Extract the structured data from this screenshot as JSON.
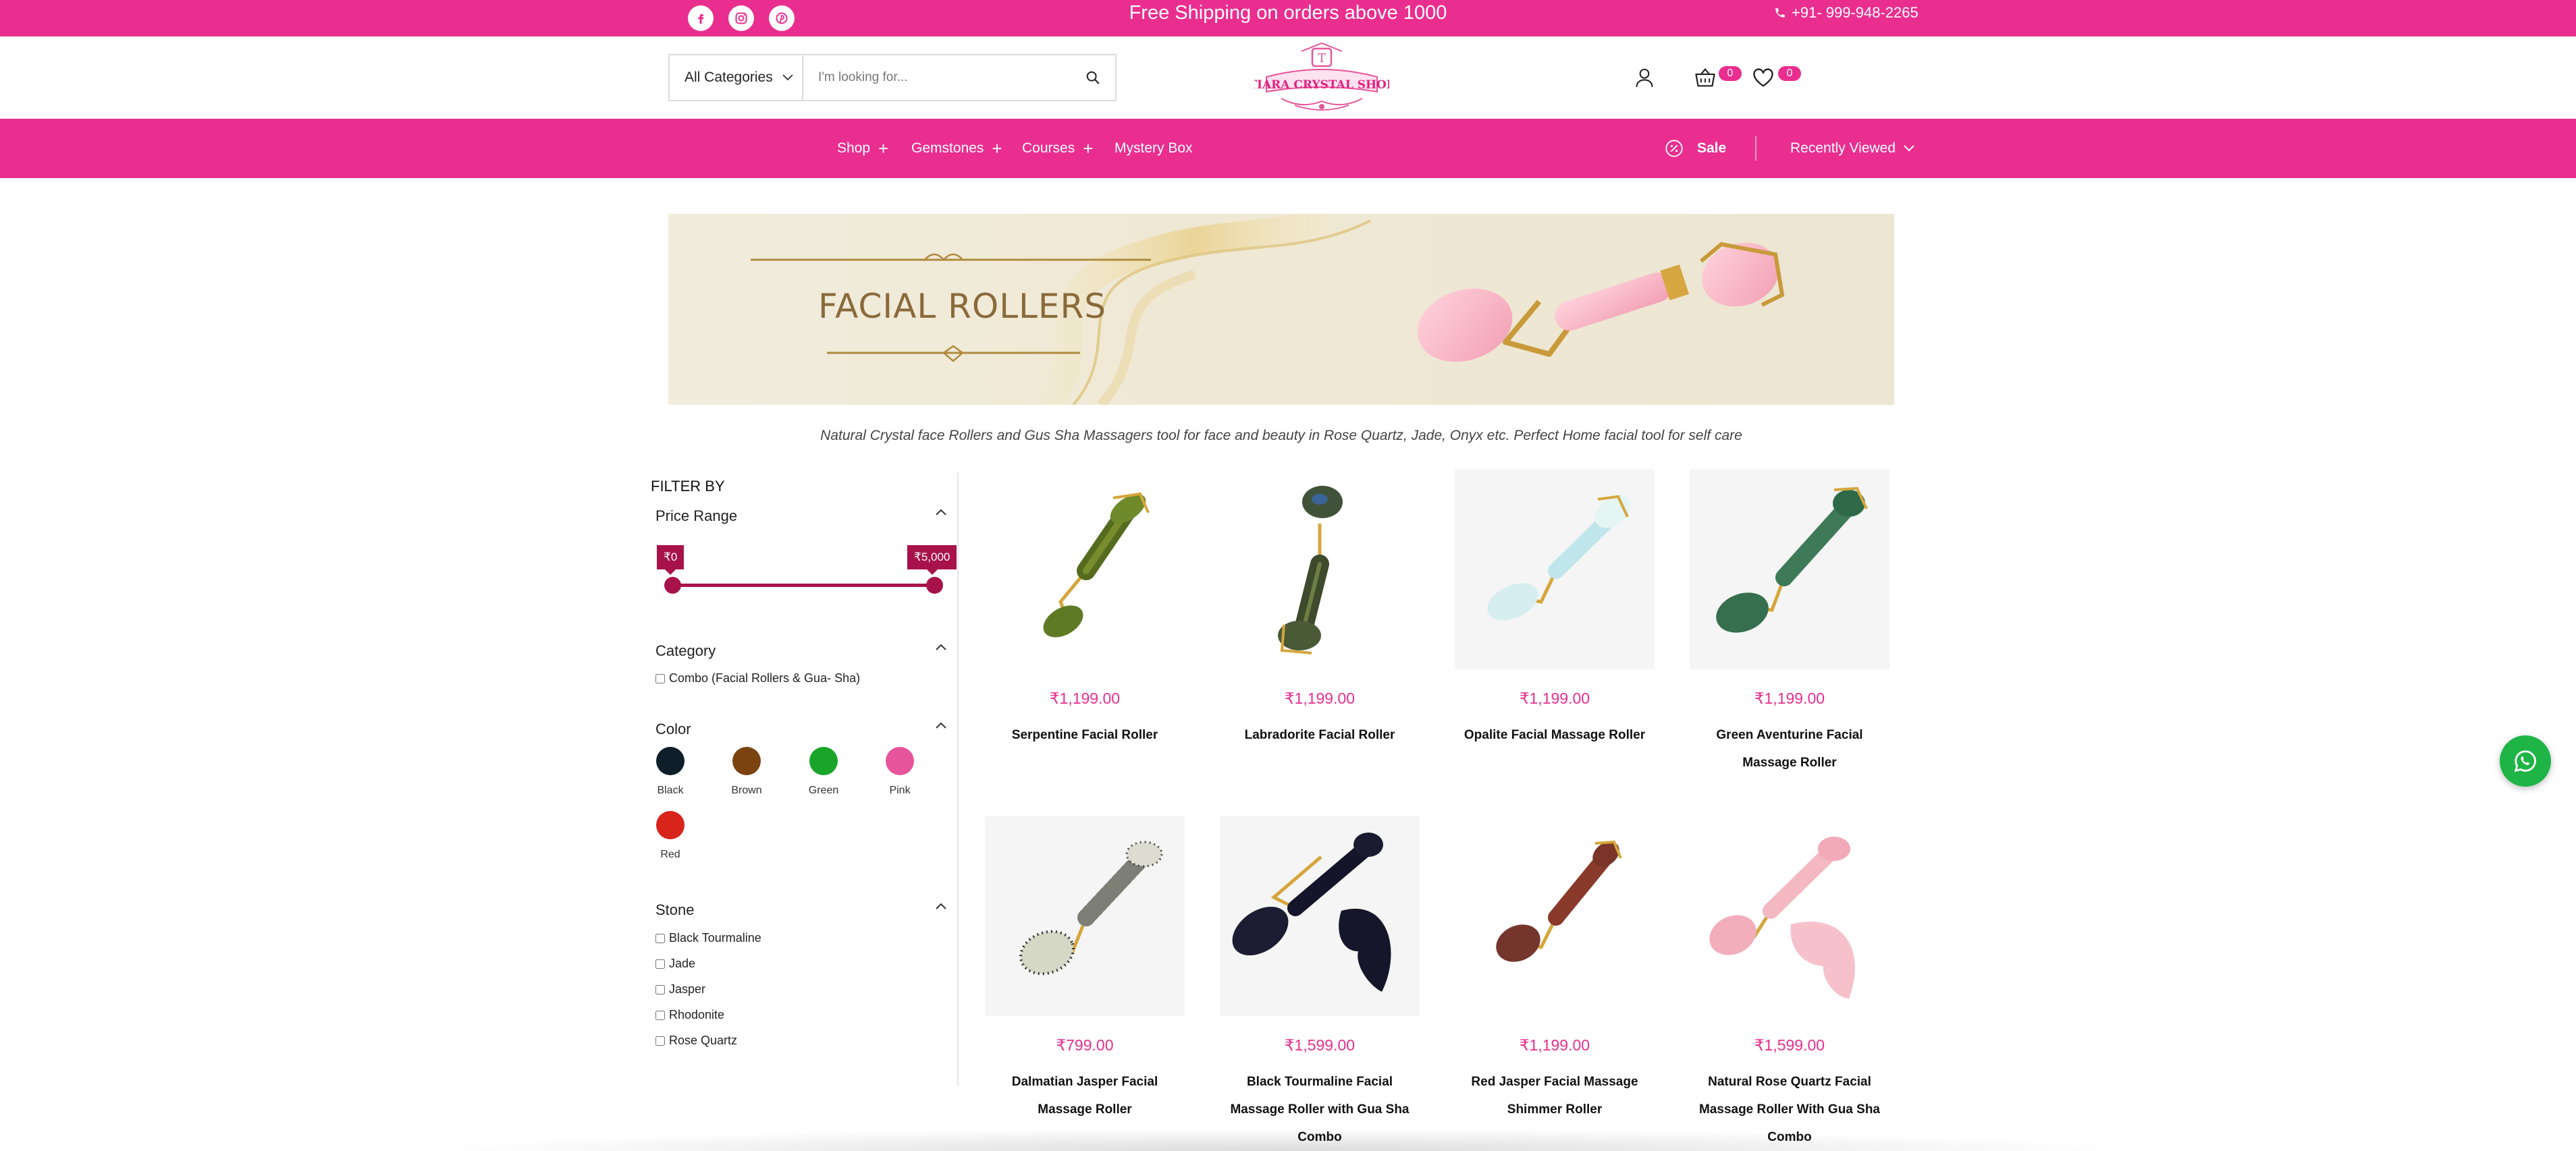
{
  "promo_bar": {
    "text": "Free Shipping on orders above 1000",
    "phone": "+91- 999-948-2265",
    "social_icons": [
      "facebook-icon",
      "instagram-icon",
      "pinterest-icon"
    ],
    "background": "#ea2e8f"
  },
  "header": {
    "category_select": "All Categories",
    "search_placeholder": "I'm looking for...",
    "logo_text": "TIARA CRYSTAL SHOP",
    "logo_monogram": "T",
    "cart_count": "0",
    "wishlist_count": "0"
  },
  "nav": {
    "items": [
      {
        "label": "Shop",
        "expandable": true
      },
      {
        "label": "Gemstones",
        "expandable": true
      },
      {
        "label": "Courses",
        "expandable": true
      },
      {
        "label": "Mystery Box",
        "expandable": false
      }
    ],
    "sale_label": "Sale",
    "recently_viewed_label": "Recently Viewed"
  },
  "banner": {
    "title": "FACIAL ROLLERS"
  },
  "category_description": "Natural Crystal face Rollers and Gus Sha Massagers tool for face and beauty in Rose Quartz, Jade, Onyx etc. Perfect Home facial tool for self care",
  "filters": {
    "heading": "FILTER BY",
    "price_range": {
      "title": "Price Range",
      "min_label": "₹0",
      "max_label": "₹5,000",
      "min_value": 0,
      "max_value": 5000
    },
    "category": {
      "title": "Category",
      "options": [
        "Combo (Facial Rollers & Gua- Sha)"
      ]
    },
    "color": {
      "title": "Color",
      "options": [
        {
          "label": "Black",
          "color": "#0e1f2a"
        },
        {
          "label": "Brown",
          "color": "#7a4310"
        },
        {
          "label": "Green",
          "color": "#18a52a"
        },
        {
          "label": "Pink",
          "color": "#e6559b"
        },
        {
          "label": "Red",
          "color": "#d9241b"
        }
      ]
    },
    "stone": {
      "title": "Stone",
      "options": [
        "Black Tourmaline",
        "Jade",
        "Jasper",
        "Rhodonite",
        "Rose Quartz"
      ]
    }
  },
  "products": [
    {
      "name": "Serpentine Facial Roller",
      "price": "₹1,199.00"
    },
    {
      "name": "Labradorite Facial Roller",
      "price": "₹1,199.00"
    },
    {
      "name": "Opalite Facial Massage Roller",
      "price": "₹1,199.00"
    },
    {
      "name": "Green Aventurine Facial Massage Roller",
      "price": "₹1,199.00"
    },
    {
      "name": "Dalmatian Jasper Facial Massage Roller",
      "price": "₹799.00"
    },
    {
      "name": "Black Tourmaline Facial Massage Roller with Gua Sha Combo",
      "price": "₹1,599.00"
    },
    {
      "name": "Red Jasper Facial Massage Shimmer Roller",
      "price": "₹1,199.00"
    },
    {
      "name": "Natural Rose Quartz Facial Massage Roller With Gua Sha Combo",
      "price": "₹1,599.00"
    }
  ]
}
